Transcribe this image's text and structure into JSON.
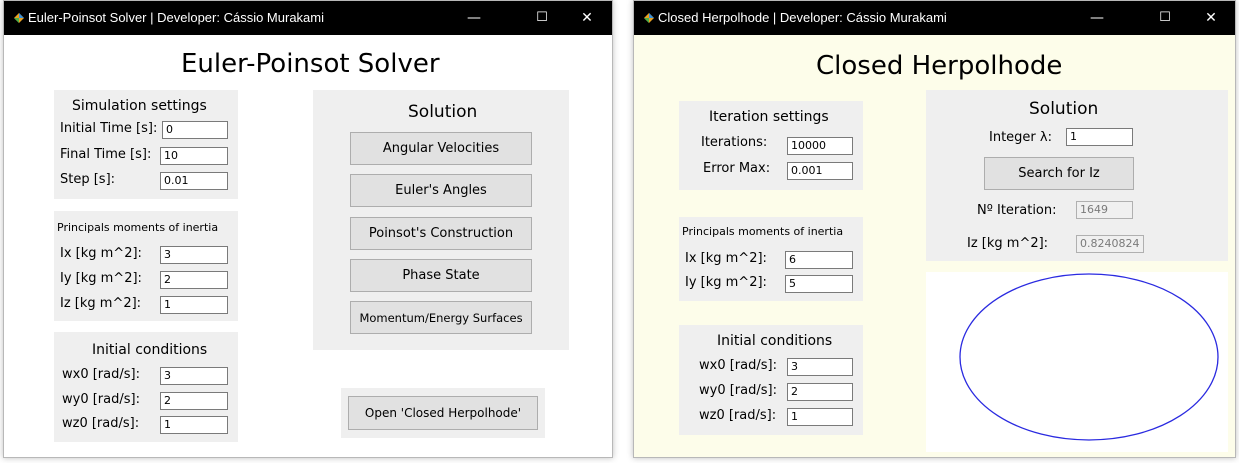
{
  "window1": {
    "title": "Euler-Poinsot Solver  |  Developer: Cássio Murakami",
    "heading": "Euler-Poinsot Solver",
    "controls": {
      "minimize": "—",
      "maximize": "☐",
      "close": "✕"
    },
    "simulation": {
      "title": "Simulation settings",
      "initial_time": {
        "label": "Initial Time [s]:",
        "value": "0"
      },
      "final_time": {
        "label": "Final Time [s]:",
        "value": "10"
      },
      "step": {
        "label": "Step [s]:",
        "value": "0.01"
      }
    },
    "inertia": {
      "title": "Principals moments of inertia",
      "ix": {
        "label": "Ix [kg m^2]:",
        "value": "3"
      },
      "iy": {
        "label": "Iy [kg m^2]:",
        "value": "2"
      },
      "iz": {
        "label": "Iz [kg m^2]:",
        "value": "1"
      }
    },
    "initial": {
      "title": "Initial conditions",
      "wx0": {
        "label": "wx0 [rad/s]:",
        "value": "3"
      },
      "wy0": {
        "label": "wy0 [rad/s]:",
        "value": "2"
      },
      "wz0": {
        "label": "wz0 [rad/s]:",
        "value": "1"
      }
    },
    "solution": {
      "title": "Solution",
      "buttons": [
        "Angular Velocities",
        "Euler's Angles",
        "Poinsot's Construction",
        "Phase State",
        "Momentum/Energy Surfaces"
      ]
    },
    "open_button": "Open 'Closed Herpolhode'"
  },
  "window2": {
    "title": "Closed Herpolhode  |  Developer: Cássio Murakami",
    "heading": "Closed Herpolhode",
    "controls": {
      "minimize": "—",
      "maximize": "☐",
      "close": "✕"
    },
    "iteration": {
      "title": "Iteration settings",
      "iterations": {
        "label": "Iterations:",
        "value": "10000"
      },
      "error_max": {
        "label": "Error Max:",
        "value": "0.001"
      }
    },
    "inertia": {
      "title": "Principals moments of inertia",
      "ix": {
        "label": "Ix [kg m^2]:",
        "value": "6"
      },
      "iy": {
        "label": "Iy [kg m^2]:",
        "value": "5"
      }
    },
    "initial": {
      "title": "Initial conditions",
      "wx0": {
        "label": "wx0 [rad/s]:",
        "value": "3"
      },
      "wy0": {
        "label": "wy0 [rad/s]:",
        "value": "2"
      },
      "wz0": {
        "label": "wz0 [rad/s]:",
        "value": "1"
      }
    },
    "solution": {
      "title": "Solution",
      "integer_lambda": {
        "label": "Integer λ:",
        "value": "1"
      },
      "search_button": "Search for Iz",
      "iteration_no": {
        "label": "Nº Iteration:",
        "value": "1649"
      },
      "iz": {
        "label": "Iz [kg m^2]:",
        "value": "0.8240824"
      }
    },
    "plot_color": "#2a2ae0"
  }
}
